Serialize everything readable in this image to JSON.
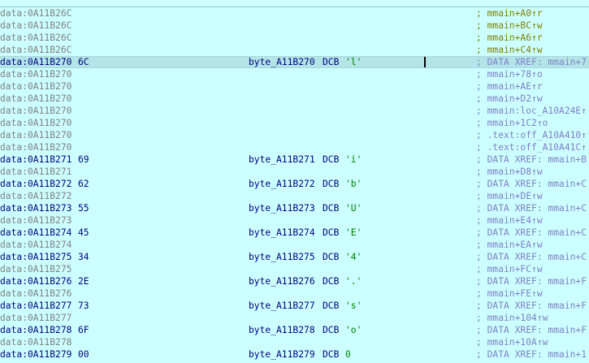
{
  "rows": [
    {
      "addr": "data:0A11B26C",
      "comment": "; mmain+A0↑r",
      "cstyle": "y"
    },
    {
      "addr": "data:0A11B26C",
      "comment": "; mmain+BC↑w",
      "cstyle": "y"
    },
    {
      "addr": "data:0A11B26C",
      "comment": "; mmain+A6↑r",
      "cstyle": "y"
    },
    {
      "addr": "data:0A11B26C",
      "comment": "; mmain+C4↑w",
      "cstyle": "y"
    },
    {
      "addr": "data:0A11B270",
      "hex": "6C",
      "label": "byte_A11B270",
      "instr": "DCB",
      "operand": "'l'",
      "comment": "; DATA XREF: mmain+7",
      "cstyle": "b",
      "selected": true,
      "caret": true
    },
    {
      "addr": "data:0A11B270",
      "comment": "; mmain+78↑o",
      "cstyle": "b"
    },
    {
      "addr": "data:0A11B270",
      "comment": "; mmain+AE↑r",
      "cstyle": "b"
    },
    {
      "addr": "data:0A11B270",
      "comment": "; mmain+D2↑w",
      "cstyle": "b"
    },
    {
      "addr": "data:0A11B270",
      "comment": "; mmain:loc_A10A24E↑",
      "cstyle": "b"
    },
    {
      "addr": "data:0A11B270",
      "comment": "; mmain+1C2↑o",
      "cstyle": "b"
    },
    {
      "addr": "data:0A11B270",
      "comment": "; .text:off_A10A410↑",
      "cstyle": "b"
    },
    {
      "addr": "data:0A11B270",
      "comment": "; .text:off_A10A41C↑",
      "cstyle": "b"
    },
    {
      "addr": "data:0A11B271",
      "hex": "69",
      "label": "byte_A11B271",
      "instr": "DCB",
      "operand": "'i'",
      "comment": "; DATA XREF: mmain+B",
      "cstyle": "b"
    },
    {
      "addr": "data:0A11B271",
      "comment": "; mmain+D8↑w",
      "cstyle": "b"
    },
    {
      "addr": "data:0A11B272",
      "hex": "62",
      "label": "byte_A11B272",
      "instr": "DCB",
      "operand": "'b'",
      "comment": "; DATA XREF: mmain+C",
      "cstyle": "b"
    },
    {
      "addr": "data:0A11B272",
      "comment": "; mmain+DE↑w",
      "cstyle": "b"
    },
    {
      "addr": "data:0A11B273",
      "hex": "55",
      "label": "byte_A11B273",
      "instr": "DCB",
      "operand": "'U'",
      "comment": "; DATA XREF: mmain+C",
      "cstyle": "b"
    },
    {
      "addr": "data:0A11B273",
      "comment": "; mmain+E4↑w",
      "cstyle": "b"
    },
    {
      "addr": "data:0A11B274",
      "hex": "45",
      "label": "byte_A11B274",
      "instr": "DCB",
      "operand": "'E'",
      "comment": "; DATA XREF: mmain+C",
      "cstyle": "b"
    },
    {
      "addr": "data:0A11B274",
      "comment": "; mmain+EA↑w",
      "cstyle": "b"
    },
    {
      "addr": "data:0A11B275",
      "hex": "34",
      "label": "byte_A11B275",
      "instr": "DCB",
      "operand": "'4'",
      "comment": "; DATA XREF: mmain+C",
      "cstyle": "b"
    },
    {
      "addr": "data:0A11B275",
      "comment": "; mmain+FC↑w",
      "cstyle": "b"
    },
    {
      "addr": "data:0A11B276",
      "hex": "2E",
      "label": "byte_A11B276",
      "instr": "DCB",
      "operand": "'.'",
      "comment": "; DATA XREF: mmain+F",
      "cstyle": "b"
    },
    {
      "addr": "data:0A11B276",
      "comment": "; mmain+FE↑w",
      "cstyle": "b"
    },
    {
      "addr": "data:0A11B277",
      "hex": "73",
      "label": "byte_A11B277",
      "instr": "DCB",
      "operand": "'s'",
      "comment": "; DATA XREF: mmain+F",
      "cstyle": "b"
    },
    {
      "addr": "data:0A11B277",
      "comment": "; mmain+104↑w",
      "cstyle": "b"
    },
    {
      "addr": "data:0A11B278",
      "hex": "6F",
      "label": "byte_A11B278",
      "instr": "DCB",
      "operand": "'o'",
      "comment": "; DATA XREF: mmain+F",
      "cstyle": "b"
    },
    {
      "addr": "data:0A11B278",
      "comment": "; mmain+10A↑w",
      "cstyle": "b"
    },
    {
      "addr": "data:0A11B279",
      "hex": "00",
      "label": "byte_A11B279",
      "instr": "DCB",
      "operand": "0",
      "comment": "; DATA XREF: mmain+1",
      "cstyle": "b"
    }
  ]
}
